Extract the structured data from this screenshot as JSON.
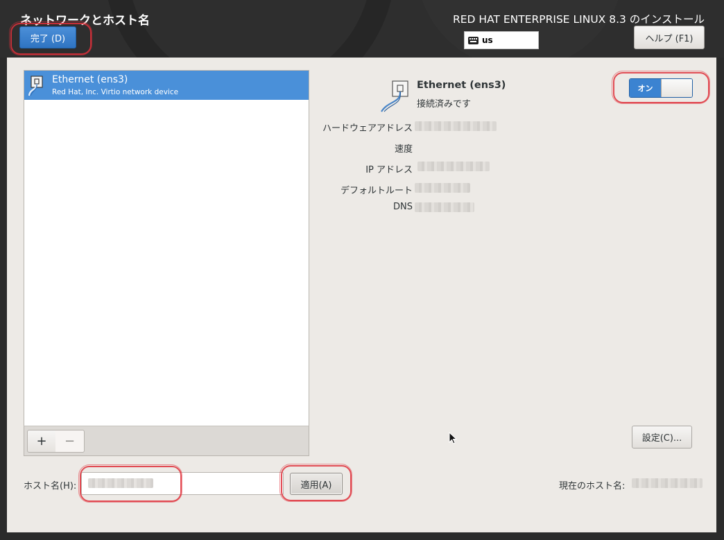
{
  "header": {
    "title": "ネットワークとホスト名",
    "product": "RED HAT ENTERPRISE LINUX 8.3 のインストール",
    "done_label": "完了 (D)",
    "keyboard_layout": "us",
    "help_label": "ヘルプ (F1)"
  },
  "devices": [
    {
      "name": "Ethernet (ens3)",
      "description": "Red Hat, Inc. Virtio network device"
    }
  ],
  "list_toolbar": {
    "add_label": "+",
    "remove_label": "−"
  },
  "detail": {
    "name": "Ethernet (ens3)",
    "status": "接続済みです",
    "switch_label": "オン",
    "labels": {
      "hw_address": "ハードウェアアドレス",
      "speed": "速度",
      "ip_address": "IP アドレス",
      "default_route": "デフォルトルート",
      "dns": "DNS"
    },
    "settings_label": "設定(C)..."
  },
  "hostname": {
    "label": "ホスト名(H):",
    "apply_label": "適用(A)",
    "current_label": "現在のホスト名:"
  },
  "colors": {
    "accent": "#4a90d9",
    "header_bg": "#2e2e2e",
    "panel_bg": "#edeae6",
    "annotation": "#e0303a"
  }
}
